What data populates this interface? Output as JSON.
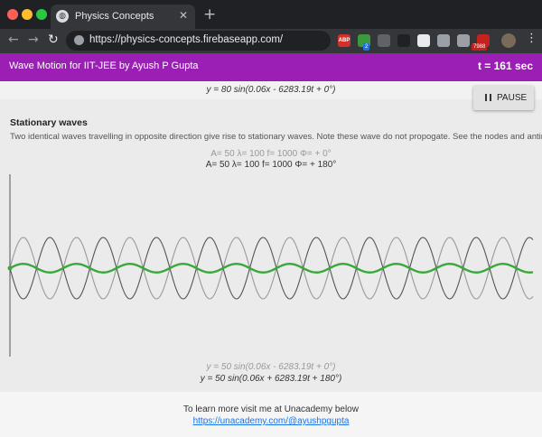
{
  "browser": {
    "tab_title": "Physics Concepts",
    "tab_close": "✕",
    "new_tab": "+",
    "url": "https://physics-concepts.firebaseapp.com/",
    "back": "←",
    "forward": "→",
    "reload": "↻",
    "menu": "⋮",
    "extensions": [
      {
        "icon": "abp-icon",
        "label": "ABP",
        "color": "#d0312d"
      },
      {
        "icon": "extension-green-icon",
        "label": "",
        "color": "#3c9a3c",
        "badge": "2"
      },
      {
        "icon": "lightbulb-icon",
        "label": "",
        "color": "#5f6368"
      },
      {
        "icon": "bomb-icon",
        "label": "",
        "color": "#202124"
      },
      {
        "icon": "circle-icon",
        "label": "",
        "color": "#e8eaed"
      },
      {
        "icon": "save-icon",
        "label": "",
        "color": "#9aa0a6"
      },
      {
        "icon": "vue-icon",
        "label": "",
        "color": "#9aa0a6"
      },
      {
        "icon": "mail-icon",
        "label": "",
        "color": "#c5221f",
        "badge": "7988"
      }
    ]
  },
  "app": {
    "title": "Wave Motion for IIT-JEE by Ayush P Gupta",
    "timer": "t = 161 sec",
    "accent": "#9b1fb5"
  },
  "previous_equation": "y = 80 sin(0.06x - 6283.19t + 0°)",
  "pause_button": "PAUSE",
  "section": {
    "title": "Stationary waves",
    "description": "Two identical waves travelling in opposite direction give rise to stationary waves. Note these wave do not propogate. See the nodes and antinodes.",
    "params_wave1": "A= 50  λ= 100  f= 1000  Φ= + 0°",
    "params_wave2": "A= 50  λ= 100  f= 1000  Φ= + 180°",
    "equation_wave1": "y = 50 sin(0.06x - 6283.19t + 0°)",
    "equation_wave2": "y = 50 sin(0.06x + 6283.19t + 180°)"
  },
  "footer": {
    "text": "To learn more visit me at Unacademy below",
    "link": "https://unacademy.com/@ayushpgupta"
  },
  "chart_data": {
    "type": "line",
    "series": [
      {
        "amplitude": 50,
        "wavelength": 100,
        "phase_deg": 0,
        "color": "#9a9a9a"
      },
      {
        "amplitude": 50,
        "wavelength": 100,
        "phase_deg": 180,
        "color": "#555555"
      },
      {
        "amplitude": 7,
        "wavelength": 100,
        "color": "#3aa83a"
      }
    ],
    "grid": false
  }
}
